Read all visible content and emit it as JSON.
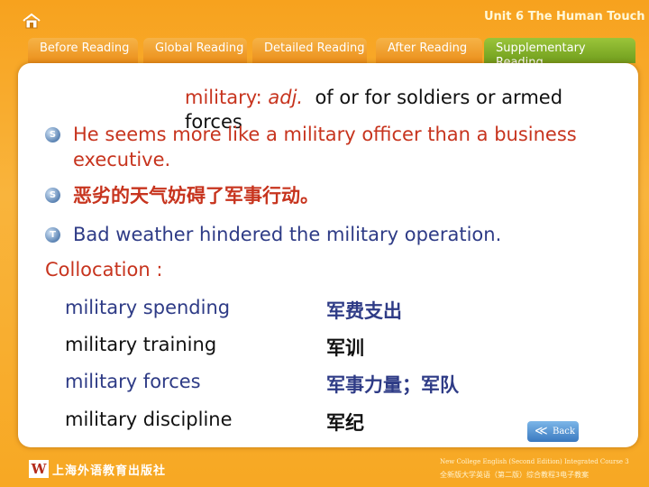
{
  "header": {
    "unit_title": "Unit 6 The Human Touch",
    "tabs": [
      {
        "label": "Before Reading",
        "active": false
      },
      {
        "label": "Global Reading",
        "active": false
      },
      {
        "label": "Detailed Reading",
        "active": false
      },
      {
        "label": "After Reading",
        "active": false
      },
      {
        "label": "Supplementary Reading",
        "active": true
      }
    ]
  },
  "definition": {
    "word": "military",
    "colon": ": ",
    "pos": "adj.",
    "meaning": "of or for soldiers or armed forces"
  },
  "examples": [
    {
      "marker": "S",
      "text": "He seems more like a military officer than a business executive."
    },
    {
      "marker": "S",
      "text": "恶劣的天气妨碍了军事行动。"
    },
    {
      "marker": "T",
      "text": "Bad weather hindered the military operation."
    }
  ],
  "collocation": {
    "label": "Collocation :",
    "rows": [
      {
        "en": "military spending",
        "cn": "军费支出"
      },
      {
        "en": "military training",
        "cn": "军训"
      },
      {
        "en": "military forces",
        "cn": "军事力量；军队"
      },
      {
        "en": "military discipline",
        "cn": "军纪"
      }
    ]
  },
  "back_button": {
    "arrow": "≪",
    "label": "Back"
  },
  "footer": {
    "publisher_logo": "W",
    "publisher": "上海外语教育出版社",
    "course_en": "New College English (Second Edition) Integrated Course 3",
    "course_cn": "全新版大学英语（第二版）综合教程3电子教案"
  },
  "colors": {
    "accent_red": "#c7341e",
    "navy": "#2e3b86",
    "tab_orange": "#eb8f1a",
    "tab_active_green": "#6f9d1c",
    "back_blue": "#3a79c0"
  }
}
